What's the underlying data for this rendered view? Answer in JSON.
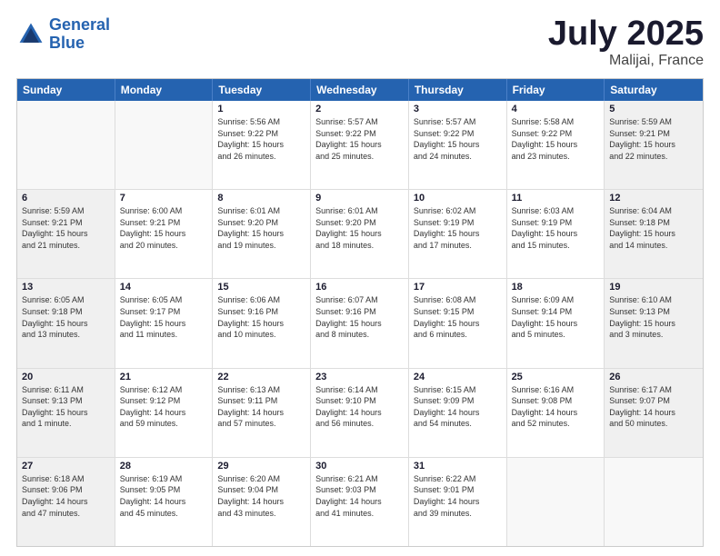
{
  "header": {
    "logo_line1": "General",
    "logo_line2": "Blue",
    "title": "July 2025",
    "subtitle": "Malijai, France"
  },
  "calendar": {
    "days": [
      "Sunday",
      "Monday",
      "Tuesday",
      "Wednesday",
      "Thursday",
      "Friday",
      "Saturday"
    ],
    "rows": [
      [
        {
          "day": "",
          "info": "",
          "empty": true
        },
        {
          "day": "",
          "info": "",
          "empty": true
        },
        {
          "day": "1",
          "info": "Sunrise: 5:56 AM\nSunset: 9:22 PM\nDaylight: 15 hours\nand 26 minutes."
        },
        {
          "day": "2",
          "info": "Sunrise: 5:57 AM\nSunset: 9:22 PM\nDaylight: 15 hours\nand 25 minutes."
        },
        {
          "day": "3",
          "info": "Sunrise: 5:57 AM\nSunset: 9:22 PM\nDaylight: 15 hours\nand 24 minutes."
        },
        {
          "day": "4",
          "info": "Sunrise: 5:58 AM\nSunset: 9:22 PM\nDaylight: 15 hours\nand 23 minutes."
        },
        {
          "day": "5",
          "info": "Sunrise: 5:59 AM\nSunset: 9:21 PM\nDaylight: 15 hours\nand 22 minutes.",
          "shaded": true
        }
      ],
      [
        {
          "day": "6",
          "info": "Sunrise: 5:59 AM\nSunset: 9:21 PM\nDaylight: 15 hours\nand 21 minutes.",
          "shaded": true
        },
        {
          "day": "7",
          "info": "Sunrise: 6:00 AM\nSunset: 9:21 PM\nDaylight: 15 hours\nand 20 minutes."
        },
        {
          "day": "8",
          "info": "Sunrise: 6:01 AM\nSunset: 9:20 PM\nDaylight: 15 hours\nand 19 minutes."
        },
        {
          "day": "9",
          "info": "Sunrise: 6:01 AM\nSunset: 9:20 PM\nDaylight: 15 hours\nand 18 minutes."
        },
        {
          "day": "10",
          "info": "Sunrise: 6:02 AM\nSunset: 9:19 PM\nDaylight: 15 hours\nand 17 minutes."
        },
        {
          "day": "11",
          "info": "Sunrise: 6:03 AM\nSunset: 9:19 PM\nDaylight: 15 hours\nand 15 minutes."
        },
        {
          "day": "12",
          "info": "Sunrise: 6:04 AM\nSunset: 9:18 PM\nDaylight: 15 hours\nand 14 minutes.",
          "shaded": true
        }
      ],
      [
        {
          "day": "13",
          "info": "Sunrise: 6:05 AM\nSunset: 9:18 PM\nDaylight: 15 hours\nand 13 minutes.",
          "shaded": true
        },
        {
          "day": "14",
          "info": "Sunrise: 6:05 AM\nSunset: 9:17 PM\nDaylight: 15 hours\nand 11 minutes."
        },
        {
          "day": "15",
          "info": "Sunrise: 6:06 AM\nSunset: 9:16 PM\nDaylight: 15 hours\nand 10 minutes."
        },
        {
          "day": "16",
          "info": "Sunrise: 6:07 AM\nSunset: 9:16 PM\nDaylight: 15 hours\nand 8 minutes."
        },
        {
          "day": "17",
          "info": "Sunrise: 6:08 AM\nSunset: 9:15 PM\nDaylight: 15 hours\nand 6 minutes."
        },
        {
          "day": "18",
          "info": "Sunrise: 6:09 AM\nSunset: 9:14 PM\nDaylight: 15 hours\nand 5 minutes."
        },
        {
          "day": "19",
          "info": "Sunrise: 6:10 AM\nSunset: 9:13 PM\nDaylight: 15 hours\nand 3 minutes.",
          "shaded": true
        }
      ],
      [
        {
          "day": "20",
          "info": "Sunrise: 6:11 AM\nSunset: 9:13 PM\nDaylight: 15 hours\nand 1 minute.",
          "shaded": true
        },
        {
          "day": "21",
          "info": "Sunrise: 6:12 AM\nSunset: 9:12 PM\nDaylight: 14 hours\nand 59 minutes."
        },
        {
          "day": "22",
          "info": "Sunrise: 6:13 AM\nSunset: 9:11 PM\nDaylight: 14 hours\nand 57 minutes."
        },
        {
          "day": "23",
          "info": "Sunrise: 6:14 AM\nSunset: 9:10 PM\nDaylight: 14 hours\nand 56 minutes."
        },
        {
          "day": "24",
          "info": "Sunrise: 6:15 AM\nSunset: 9:09 PM\nDaylight: 14 hours\nand 54 minutes."
        },
        {
          "day": "25",
          "info": "Sunrise: 6:16 AM\nSunset: 9:08 PM\nDaylight: 14 hours\nand 52 minutes."
        },
        {
          "day": "26",
          "info": "Sunrise: 6:17 AM\nSunset: 9:07 PM\nDaylight: 14 hours\nand 50 minutes.",
          "shaded": true
        }
      ],
      [
        {
          "day": "27",
          "info": "Sunrise: 6:18 AM\nSunset: 9:06 PM\nDaylight: 14 hours\nand 47 minutes.",
          "shaded": true
        },
        {
          "day": "28",
          "info": "Sunrise: 6:19 AM\nSunset: 9:05 PM\nDaylight: 14 hours\nand 45 minutes."
        },
        {
          "day": "29",
          "info": "Sunrise: 6:20 AM\nSunset: 9:04 PM\nDaylight: 14 hours\nand 43 minutes."
        },
        {
          "day": "30",
          "info": "Sunrise: 6:21 AM\nSunset: 9:03 PM\nDaylight: 14 hours\nand 41 minutes."
        },
        {
          "day": "31",
          "info": "Sunrise: 6:22 AM\nSunset: 9:01 PM\nDaylight: 14 hours\nand 39 minutes."
        },
        {
          "day": "",
          "info": "",
          "empty": true
        },
        {
          "day": "",
          "info": "",
          "empty": true,
          "shaded": true
        }
      ]
    ]
  }
}
